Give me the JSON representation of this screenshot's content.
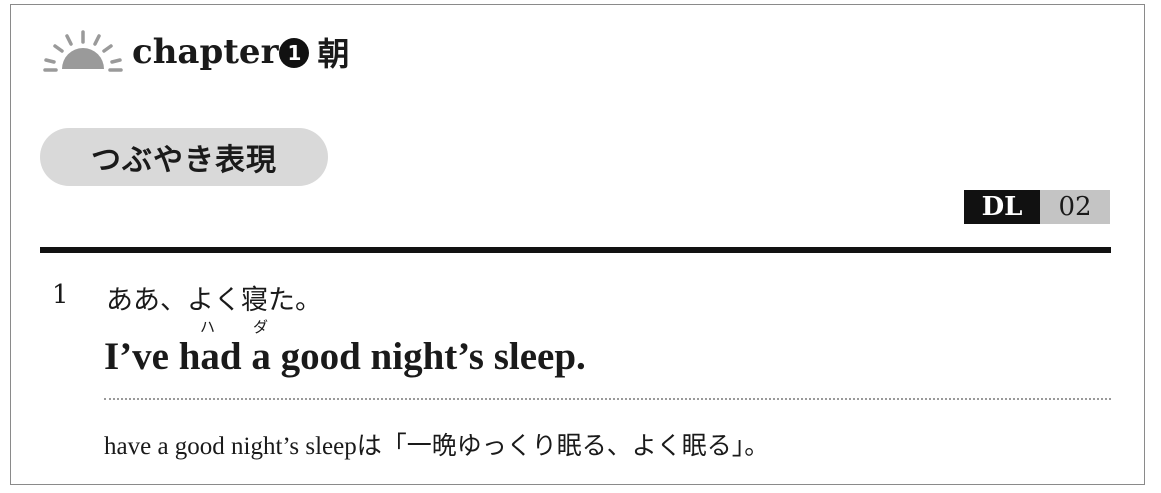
{
  "chapter": {
    "label": "chapter",
    "number": "1",
    "title": "朝",
    "icon": "sunrise-icon"
  },
  "section": {
    "label": "つぶやき表現"
  },
  "download": {
    "label": "DL",
    "number": "02"
  },
  "item": {
    "number": "1",
    "japanese": "ああ、よく寝た。",
    "ruby_ha": "ハ",
    "ruby_da": "ダ",
    "english": "I’ve had a good night’s sleep.",
    "note": "have a good night’s sleepは「一晩ゆっくり眠る、よく眠る」。"
  },
  "colors": {
    "pill": "#d9d9d9",
    "dl_dark": "#111111",
    "dl_light": "#c4c4c4",
    "sun": "#9a9a9a"
  }
}
